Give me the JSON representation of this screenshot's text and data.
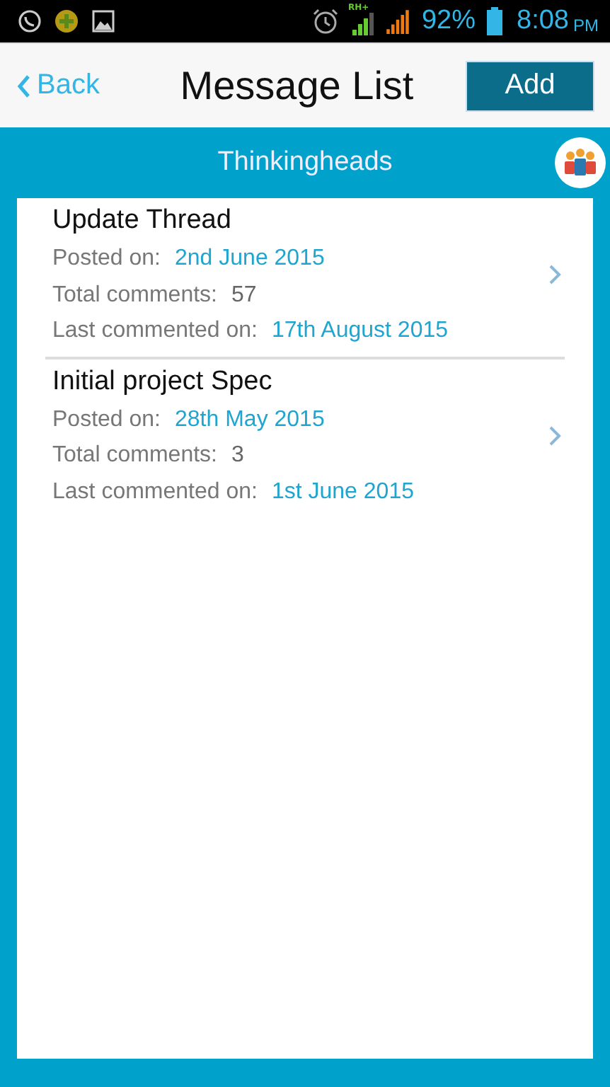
{
  "status_bar": {
    "network_label": "RH+",
    "battery": "92%",
    "time": "8:08",
    "period": "PM"
  },
  "header": {
    "back": "Back",
    "title": "Message List",
    "add": "Add"
  },
  "group": {
    "title": "Thinkingheads"
  },
  "messages": [
    {
      "title": "Update Thread",
      "posted_label": "Posted on:",
      "posted": "2nd June 2015",
      "comments_label": "Total comments:",
      "comments": "57",
      "last_label": "Last commented on:",
      "last": "17th August 2015"
    },
    {
      "title": "Initial project Spec",
      "posted_label": "Posted on:",
      "posted": "28th May 2015",
      "comments_label": "Total comments:",
      "comments": "3",
      "last_label": "Last commented on:",
      "last": "1st June 2015"
    }
  ]
}
